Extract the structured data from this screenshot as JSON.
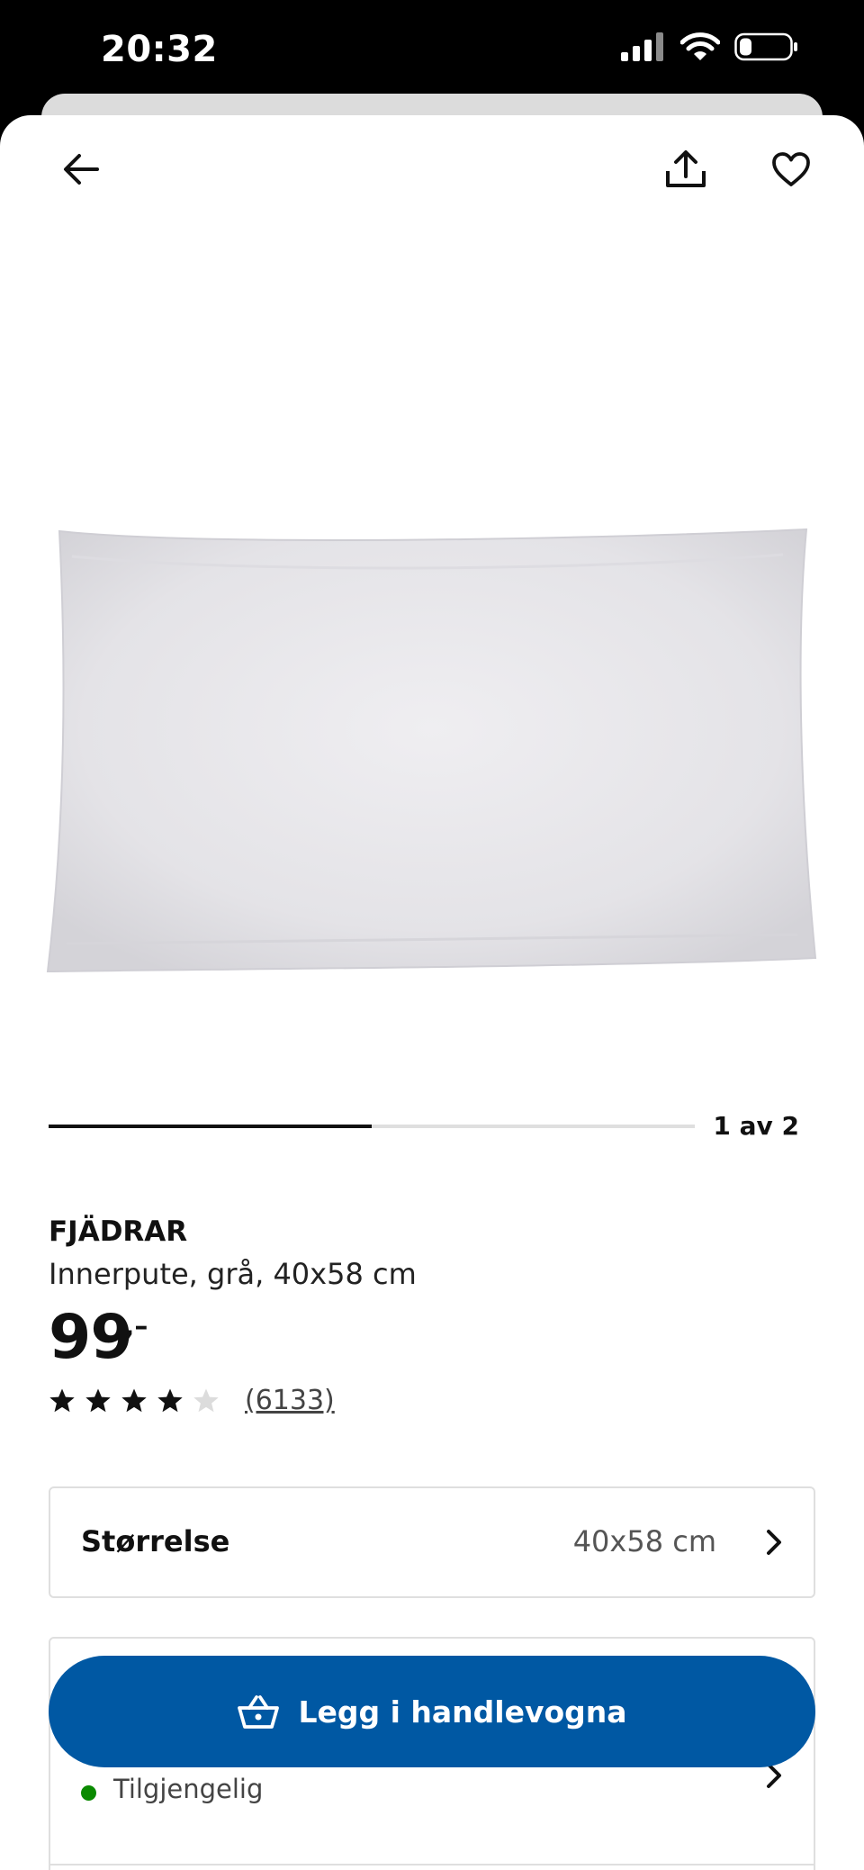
{
  "status_bar": {
    "time": "20:32"
  },
  "gallery": {
    "counter": "1 av 2",
    "progress": 0.5
  },
  "product": {
    "name": "FJÄDRAR",
    "description": "Innerpute, grå, 40x58 cm",
    "price": "99",
    "price_suffix": ",–"
  },
  "rating": {
    "stars": 4,
    "max_stars": 5,
    "review_count": "(6133)"
  },
  "size_selector": {
    "label": "Størrelse",
    "value": "40x58 cm"
  },
  "availability": {
    "status": "Tilgjengelig",
    "status_color": "#0a8a00"
  },
  "cart_button": {
    "label": "Legg i handlevogna",
    "color": "#0058a3"
  },
  "icons": [
    "back-arrow-icon",
    "share-icon",
    "heart-icon",
    "chevron-right-icon",
    "shopping-basket-icon",
    "star-icon"
  ]
}
